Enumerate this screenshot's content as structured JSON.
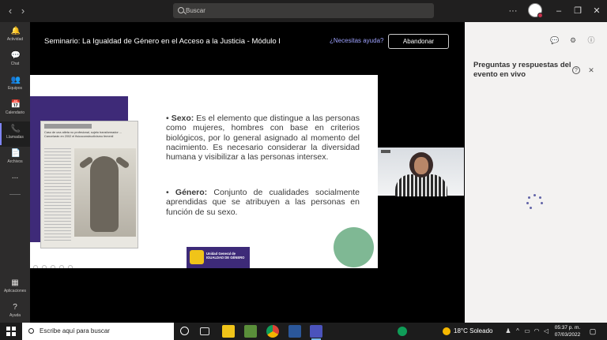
{
  "titlebar": {
    "back_icon": "chevron-left-icon",
    "forward_icon": "chevron-right-icon",
    "search_placeholder": "Buscar",
    "minimize": "–",
    "maximize": "❐",
    "close": "✕",
    "more": "···"
  },
  "rail": {
    "items": [
      {
        "label": "Actividad",
        "icon": "bell-icon",
        "glyph": "🔔"
      },
      {
        "label": "Chat",
        "icon": "chat-icon",
        "glyph": "💬"
      },
      {
        "label": "Equipos",
        "icon": "teams-icon",
        "glyph": "👥"
      },
      {
        "label": "Calendario",
        "icon": "calendar-icon",
        "glyph": "📅"
      },
      {
        "label": "Llamadas",
        "icon": "phone-icon",
        "glyph": "📞"
      },
      {
        "label": "Archivos",
        "icon": "file-icon",
        "glyph": "📄"
      },
      {
        "label": "...",
        "icon": "more-icon",
        "glyph": ""
      },
      {
        "label": "Aplicaciones",
        "icon": "apps-icon",
        "glyph": "▦"
      },
      {
        "label": "Ayuda",
        "icon": "help-icon",
        "glyph": "?"
      }
    ]
  },
  "meeting": {
    "title": "Seminario: La Igualdad de Género en el Acceso a la Justicia - Módulo I",
    "help_link": "¿Necesitas ayuda?",
    "leave_button": "Abandonar"
  },
  "slide": {
    "clipping_headline": "Caso de una atleta no profesional, sujeto transformador ... Cancelarán en 2002 el fisicoconstructivismo femenil",
    "definition_sexo_term": "Sexo:",
    "definition_sexo_text": "Es el elemento que distingue a las personas como mujeres, hombres con base en criterios biológicos, por lo general asignado al momento del nacimiento. Es necesario considerar la diversidad humana y visibilizar a las personas intersex.",
    "definition_genero_term": "Género:",
    "definition_genero_text": "Conjunto de cualidades socialmente aprendidas que se atribuyen a las personas en función de su sexo.",
    "logo_text_line1": "Unidad General de",
    "logo_text_line2": "IGUALDAD DE GÉNERO",
    "accent_color": "#7fb894",
    "bar_color": "#3e2a78"
  },
  "panel": {
    "title": "Preguntas y respuestas del evento en vivo",
    "help_icon": "?",
    "close_icon": "✕"
  },
  "taskbar": {
    "search_placeholder": "Escribe aquí para buscar",
    "weather_temp": "18°C",
    "weather_text": "Soleado",
    "time": "05:37 p. m.",
    "date": "07/03/2022"
  }
}
